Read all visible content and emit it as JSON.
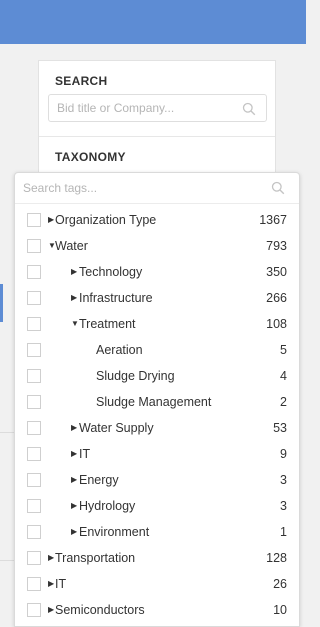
{
  "filters": {
    "search": {
      "title": "SEARCH",
      "placeholder": "Bid title or Company..."
    },
    "taxonomy": {
      "title": "TAXONOMY",
      "tags_placeholder": "Search tags..."
    }
  },
  "tags": [
    {
      "label": "Organization Type",
      "count": "1367",
      "level": 0,
      "state": "collapsed"
    },
    {
      "label": "Water",
      "count": "793",
      "level": 0,
      "state": "expanded"
    },
    {
      "label": "Technology",
      "count": "350",
      "level": 1,
      "state": "collapsed"
    },
    {
      "label": "Infrastructure",
      "count": "266",
      "level": 1,
      "state": "collapsed"
    },
    {
      "label": "Treatment",
      "count": "108",
      "level": 1,
      "state": "expanded"
    },
    {
      "label": "Aeration",
      "count": "5",
      "level": 2,
      "state": "leaf"
    },
    {
      "label": "Sludge Drying",
      "count": "4",
      "level": 2,
      "state": "leaf"
    },
    {
      "label": "Sludge Management",
      "count": "2",
      "level": 2,
      "state": "leaf"
    },
    {
      "label": "Water Supply",
      "count": "53",
      "level": 1,
      "state": "collapsed"
    },
    {
      "label": "IT",
      "count": "9",
      "level": 1,
      "state": "collapsed"
    },
    {
      "label": "Energy",
      "count": "3",
      "level": 1,
      "state": "collapsed"
    },
    {
      "label": "Hydrology",
      "count": "3",
      "level": 1,
      "state": "collapsed"
    },
    {
      "label": "Environment",
      "count": "1",
      "level": 1,
      "state": "collapsed"
    },
    {
      "label": "Transportation",
      "count": "128",
      "level": 0,
      "state": "collapsed"
    },
    {
      "label": "IT",
      "count": "26",
      "level": 0,
      "state": "collapsed"
    },
    {
      "label": "Semiconductors",
      "count": "10",
      "level": 0,
      "state": "collapsed"
    }
  ]
}
